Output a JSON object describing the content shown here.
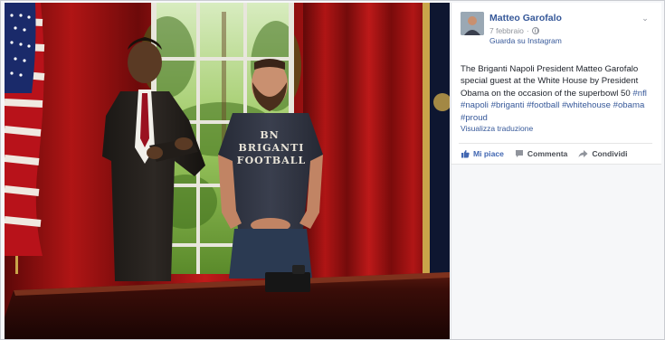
{
  "post": {
    "author": "Matteo Garofalo",
    "date": "7 febbraio",
    "separator": "·",
    "source": "Guarda su Instagram",
    "text_plain": "The Briganti Napoli President Matteo Garofalo special guest at the White House by President Obama on the occasion of the superbowl 50 ",
    "hashtags": [
      "#nfl",
      "#napoli",
      "#briganti",
      "#football",
      "#whitehouse",
      "#obama",
      "#proud"
    ],
    "translate_link": "Visualizza traduzione"
  },
  "actions": {
    "like_label": "Mi piace",
    "comment_label": "Commenta",
    "share_label": "Condividi"
  },
  "photo": {
    "shirt_top": "BRIGANTI",
    "shirt_bottom": "FOOTBALL",
    "shirt_logo": "BN"
  },
  "colors": {
    "link": "#365899",
    "like": "#4267b2",
    "text": "#1d2129",
    "meta": "#90949c"
  },
  "icons": {
    "menu": "chevron-down-icon",
    "privacy": "globe-icon",
    "like": "thumbs-up-icon",
    "comment": "speech-bubble-icon",
    "share": "share-arrow-icon"
  }
}
